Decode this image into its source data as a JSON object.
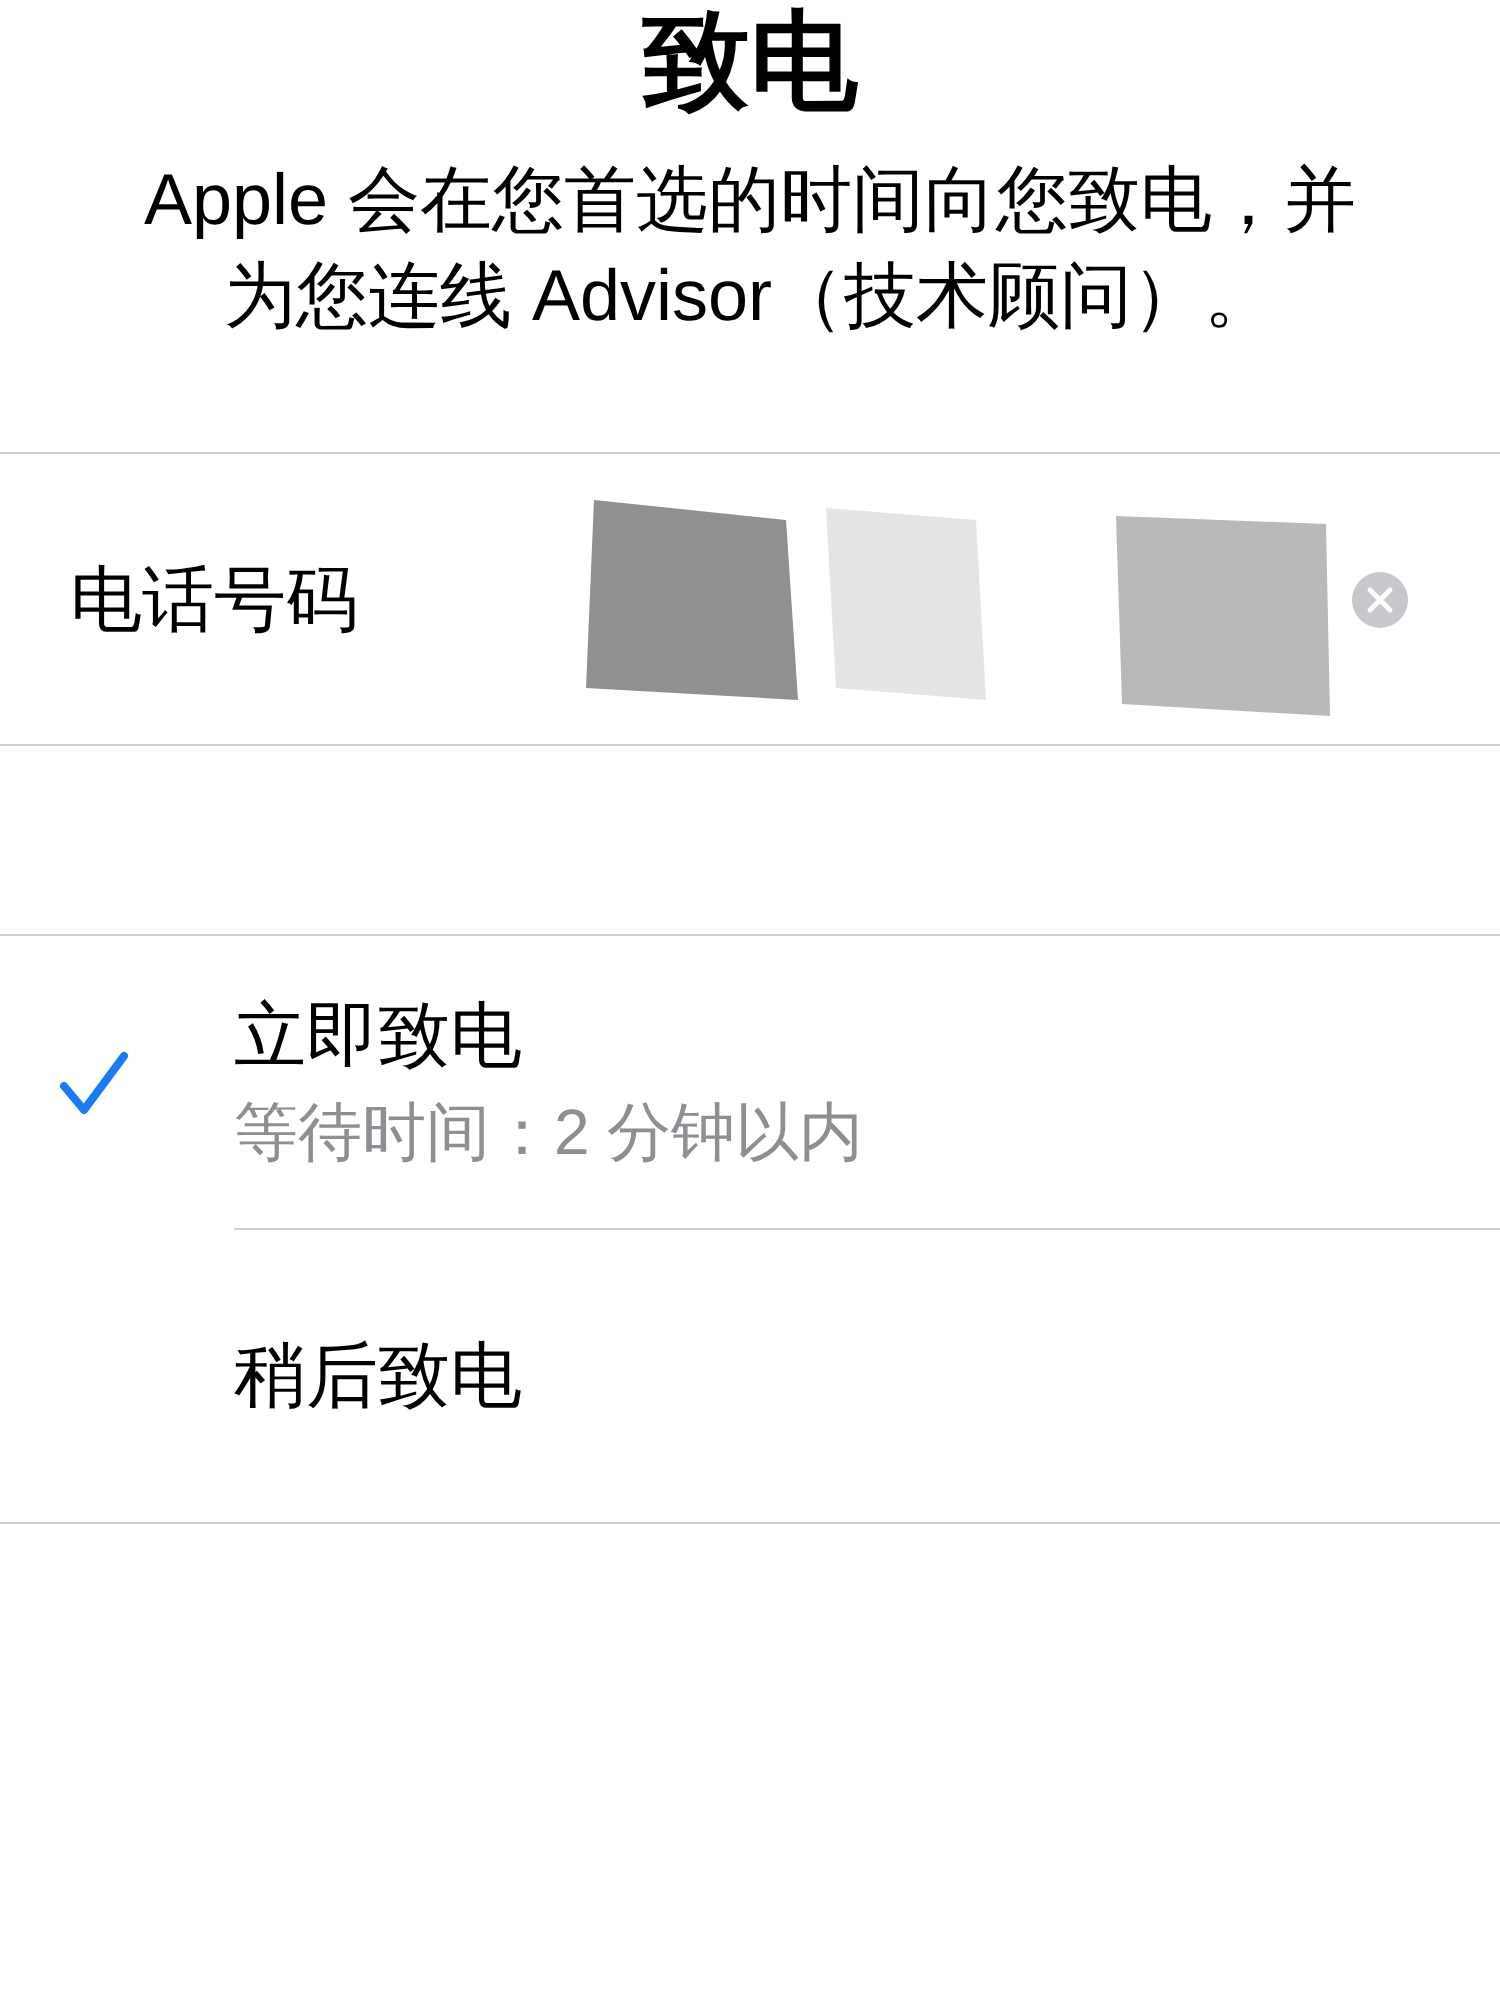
{
  "title": "致电",
  "description": "Apple 会在您首选的时间向您致电，并为您连线 Advisor（技术顾问）。",
  "phone_field": {
    "label": "电话号码"
  },
  "options": [
    {
      "title": "立即致电",
      "subtitle": "等待时间：2 分钟以内",
      "selected": true
    },
    {
      "title": "稍后致电",
      "selected": false
    }
  ]
}
